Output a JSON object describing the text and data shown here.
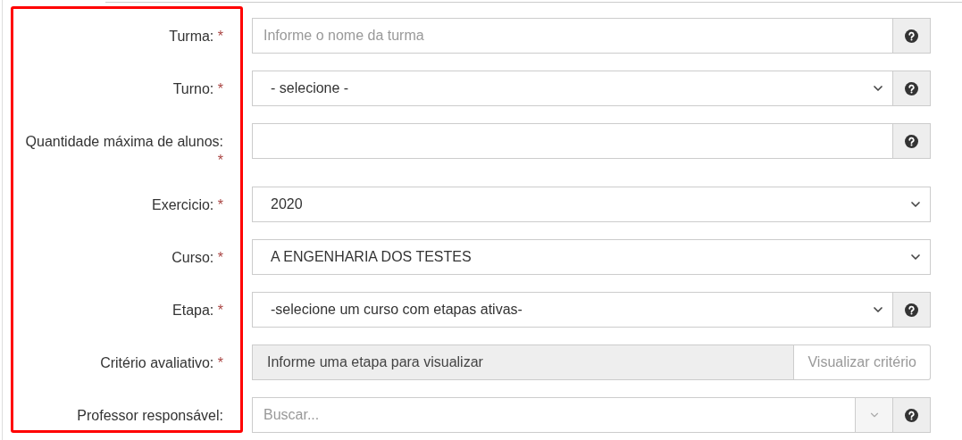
{
  "form": {
    "highlighted": true,
    "rows": [
      {
        "label": "Turma:",
        "required_mark": "*",
        "kind": "text",
        "placeholder": "Informe o nome da turma",
        "help": true
      },
      {
        "label": "Turno:",
        "required_mark": "*",
        "kind": "select",
        "value": "- selecione -",
        "help": true
      },
      {
        "label": "Quantidade máxima de alunos:",
        "required_mark": "*",
        "kind": "text",
        "help": true
      },
      {
        "label": "Exercicio:",
        "required_mark": "*",
        "kind": "select",
        "value": "2020",
        "help": false
      },
      {
        "label": "Curso:",
        "required_mark": "*",
        "kind": "select",
        "value": "A ENGENHARIA DOS TESTES",
        "help": false
      },
      {
        "label": "Etapa:",
        "required_mark": "*",
        "kind": "select",
        "value": "-selecione um curso com etapas ativas-",
        "help": true
      },
      {
        "label": "Critério avaliativo:",
        "required_mark": "*",
        "kind": "readonly",
        "value": "Informe uma etapa para visualizar",
        "button": "Visualizar critério",
        "help": false
      },
      {
        "label": "Professor responsável:",
        "kind": "combo",
        "placeholder": "Buscar...",
        "help": true
      }
    ]
  }
}
